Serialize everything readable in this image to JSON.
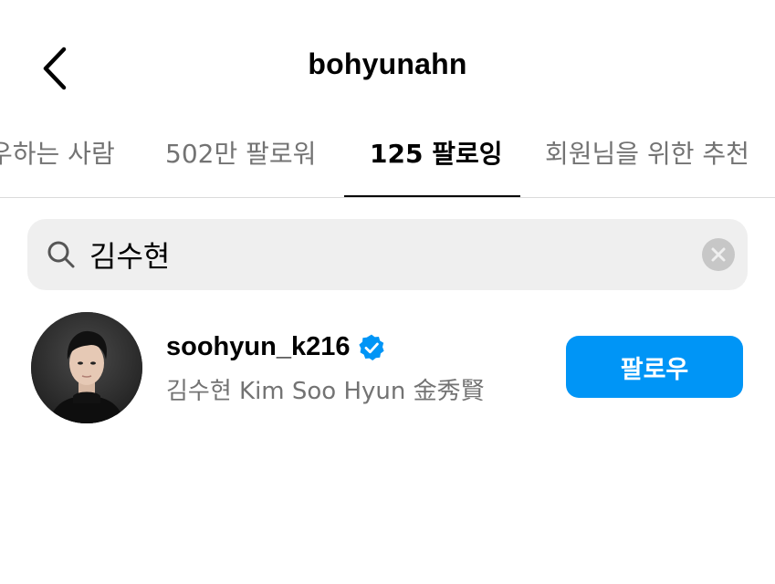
{
  "header": {
    "back_icon": "chevron-left-icon",
    "title": "bohyunahn"
  },
  "tabs": [
    {
      "label": "우하는 사람",
      "active": false
    },
    {
      "label": "502만 팔로워",
      "active": false
    },
    {
      "label": "125 팔로잉",
      "active": true
    },
    {
      "label": "회원님을 위한 추천",
      "active": false
    }
  ],
  "search": {
    "icon": "search-icon",
    "value": "김수현",
    "clear_icon": "clear-circle-icon"
  },
  "results": [
    {
      "username": "soohyun_k216",
      "verified": true,
      "full_name": "김수현 Kim Soo Hyun 金秀賢",
      "follow_label": "팔로우"
    }
  ],
  "colors": {
    "accent": "#0095f6",
    "secondary_text": "#737373",
    "search_bg": "#efefef",
    "divider": "#dbdbdb"
  }
}
